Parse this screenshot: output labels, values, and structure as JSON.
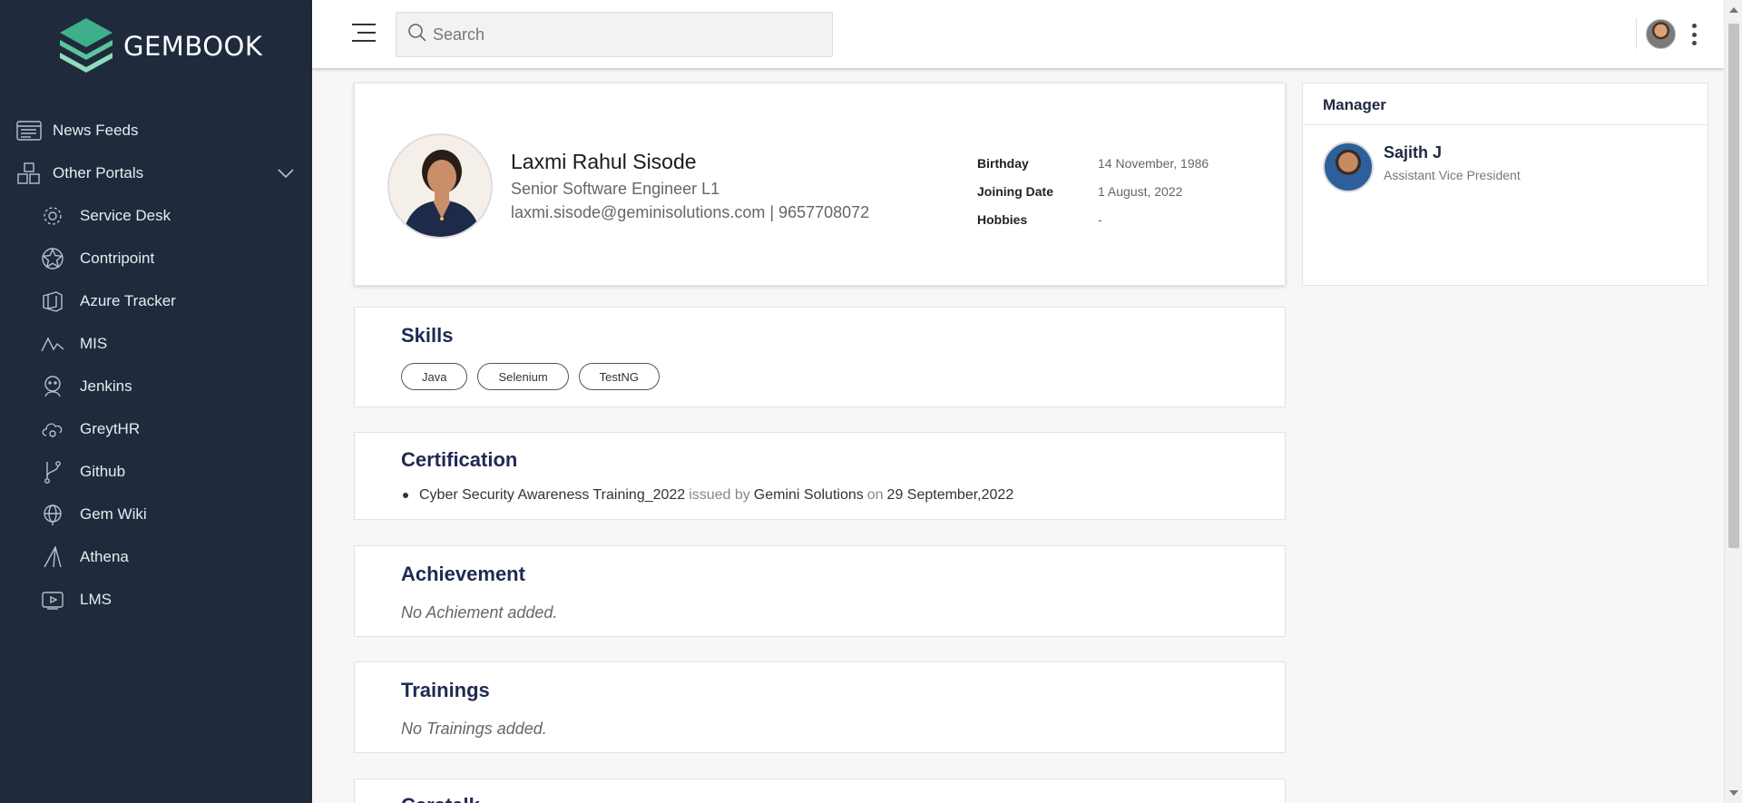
{
  "brand": {
    "name": "GEMBOOK"
  },
  "sidebar": {
    "items": [
      {
        "label": "News Feeds",
        "icon": "news-feed-icon"
      },
      {
        "label": "Other Portals",
        "icon": "portals-icon"
      }
    ],
    "sub_items": [
      {
        "label": "Service Desk",
        "icon": "gear-icon"
      },
      {
        "label": "Contripoint",
        "icon": "star-icon"
      },
      {
        "label": "Azure Tracker",
        "icon": "azure-icon"
      },
      {
        "label": "MIS",
        "icon": "chart-icon"
      },
      {
        "label": "Jenkins",
        "icon": "jenkins-icon"
      },
      {
        "label": "GreytHR",
        "icon": "cloud-icon"
      },
      {
        "label": "Github",
        "icon": "branch-icon"
      },
      {
        "label": "Gem Wiki",
        "icon": "globe-icon"
      },
      {
        "label": "Athena",
        "icon": "athena-icon"
      },
      {
        "label": "LMS",
        "icon": "lms-icon"
      }
    ]
  },
  "topbar": {
    "search_placeholder": "Search"
  },
  "profile": {
    "name": "Laxmi Rahul Sisode",
    "title": "Senior Software Engineer L1",
    "contact": "laxmi.sisode@geminisolutions.com | 9657708072",
    "info": [
      {
        "key": "Birthday",
        "value": "14 November, 1986"
      },
      {
        "key": "Joining Date",
        "value": "1 August, 2022"
      },
      {
        "key": "Hobbies",
        "value": "-"
      }
    ]
  },
  "manager": {
    "header": "Manager",
    "name": "Sajith J",
    "role": "Assistant Vice President"
  },
  "skills": {
    "title": "Skills",
    "items": [
      "Java",
      "Selenium",
      "TestNG"
    ]
  },
  "certification": {
    "title": "Certification",
    "name": "Cyber Security Awareness Training_2022",
    "issued_by_label": "issued by",
    "issuer": "Gemini Solutions",
    "on_label": "on",
    "date": "29 September,2022"
  },
  "achievement": {
    "title": "Achievement",
    "empty": "No Achiement added."
  },
  "trainings": {
    "title": "Trainings",
    "empty": "No Trainings added."
  },
  "next_section": {
    "title": "Cerstalk"
  }
}
